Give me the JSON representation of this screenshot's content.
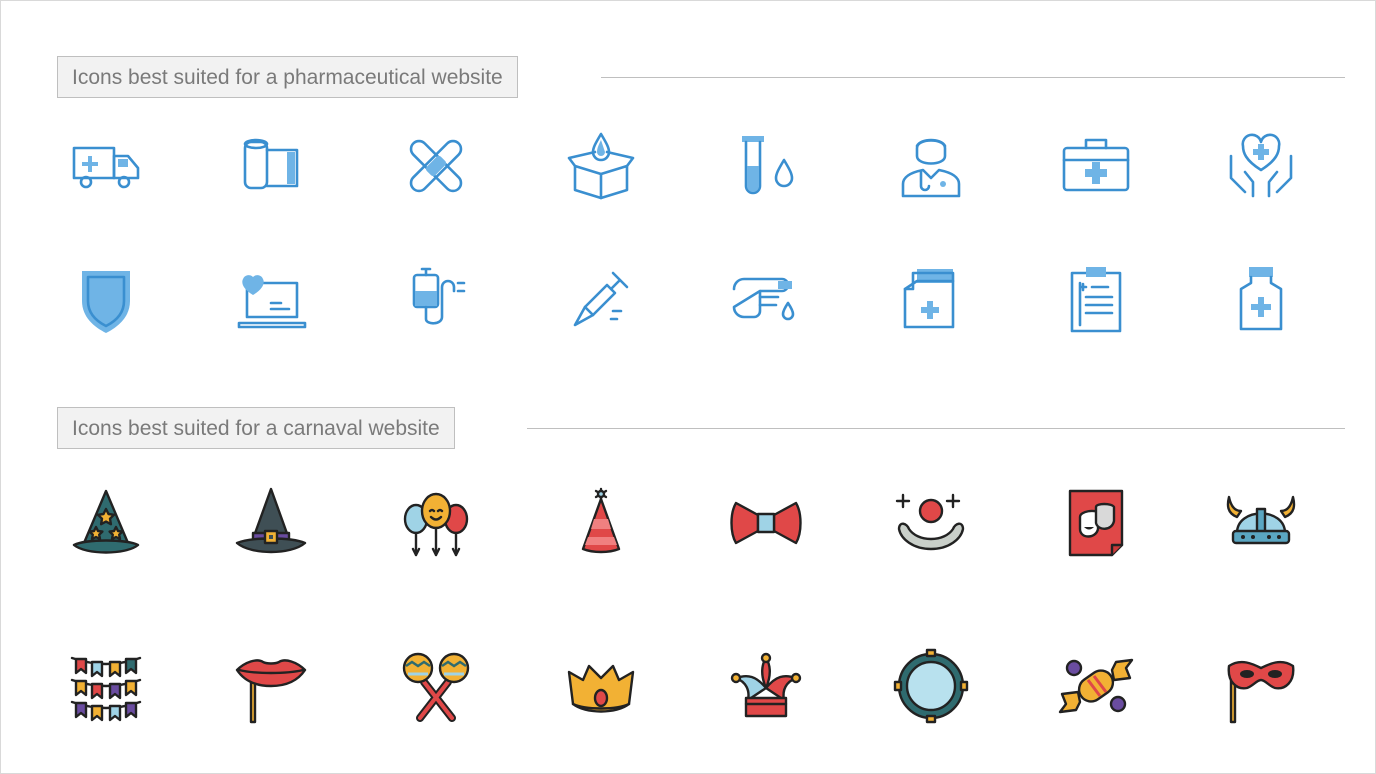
{
  "sections": [
    {
      "title": "Icons best suited for a pharmaceutical website",
      "rows": [
        [
          "ambulance-icon",
          "bandage-roll-icon",
          "crossed-bandage-icon",
          "donation-box-icon",
          "test-tube-drop-icon",
          "doctor-icon",
          "first-aid-kit-icon",
          "heart-hands-icon"
        ],
        [
          "medical-shield-icon",
          "heart-laptop-icon",
          "iv-bag-icon",
          "syringe-icon",
          "finger-prick-icon",
          "medical-folder-icon",
          "clipboard-icon",
          "medicine-bottle-icon"
        ]
      ]
    },
    {
      "title": "Icons best suited for a carnaval website",
      "rows": [
        [
          "wizard-hat-icon",
          "witch-hat-icon",
          "balloons-icon",
          "party-hat-icon",
          "bow-tie-icon",
          "clown-nose-icon",
          "theater-poster-icon",
          "viking-helmet-icon"
        ],
        [
          "bunting-flags-icon",
          "lips-prop-icon",
          "maracas-icon",
          "crown-icon",
          "jester-hat-icon",
          "tambourine-icon",
          "candy-icon",
          "eye-mask-icon"
        ]
      ]
    }
  ],
  "colors": {
    "medical_stroke": "#3a8fd0",
    "medical_fill": "#6fb4e6",
    "carnival_teal": "#2f6b6f",
    "carnival_red": "#e04848",
    "carnival_yellow": "#f2b134",
    "carnival_purple": "#6a4ca0",
    "carnival_lightblue": "#9fd3e6"
  }
}
